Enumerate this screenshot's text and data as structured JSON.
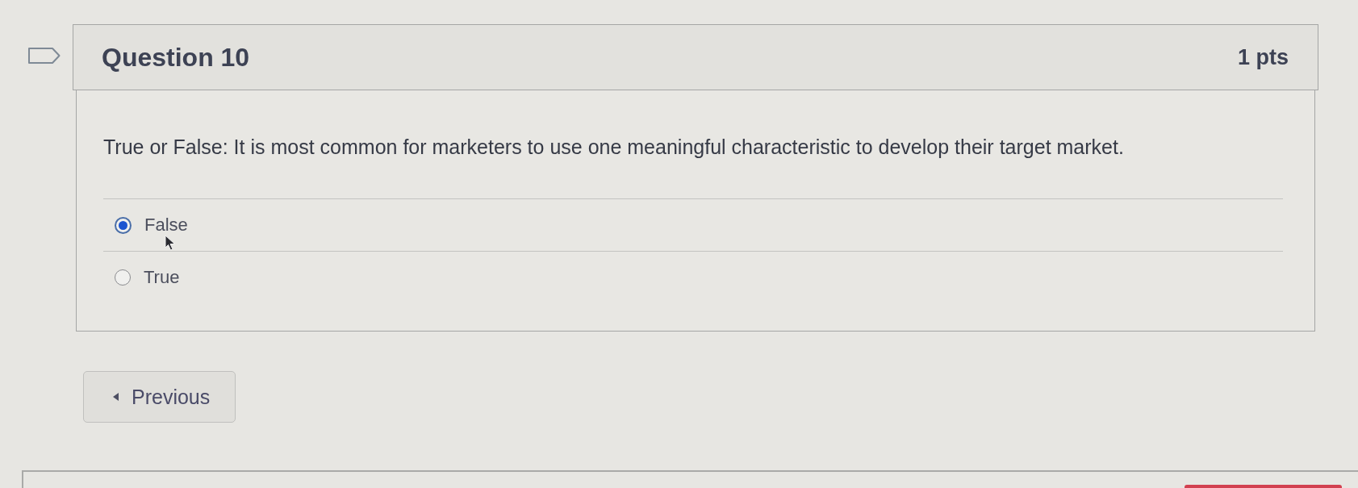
{
  "question": {
    "title": "Question 10",
    "points": "1 pts",
    "text": "True or False: It is most common for marketers to use one meaningful characteristic to develop their target market.",
    "answers": [
      {
        "label": "False",
        "selected": true
      },
      {
        "label": "True",
        "selected": false
      }
    ]
  },
  "navigation": {
    "previous_button": "Previous"
  }
}
